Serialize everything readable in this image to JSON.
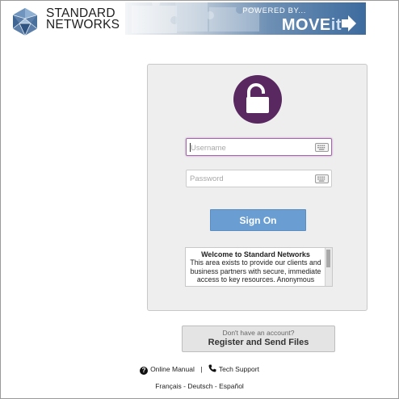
{
  "header": {
    "logo_line1": "STANDARD",
    "logo_line2": "NETWORKS",
    "powered_by": "POWERED BY...",
    "product": "MOVEit"
  },
  "login": {
    "username_placeholder": "Username",
    "password_placeholder": "Password",
    "sign_on_label": "Sign On",
    "welcome_title": "Welcome to Standard Networks",
    "welcome_body": "This area exists to provide our clients and business partners with secure, immediate access to key resources. Anonymous"
  },
  "register": {
    "question": "Don't have an account?",
    "button_label": "Register and Send Files"
  },
  "footer": {
    "online_manual": "Online Manual",
    "separator": "|",
    "tech_support": "Tech Support",
    "lang_fr": "Français",
    "lang_de": "Deutsch",
    "lang_es": "Español",
    "lang_sep": " - "
  },
  "colors": {
    "brand_purple": "#5a2860",
    "sign_on_blue": "#6a9ed2"
  },
  "icons": [
    "logo-icosahedron-icon",
    "unlock-icon",
    "keyboard-icon",
    "help-icon",
    "phone-icon"
  ]
}
